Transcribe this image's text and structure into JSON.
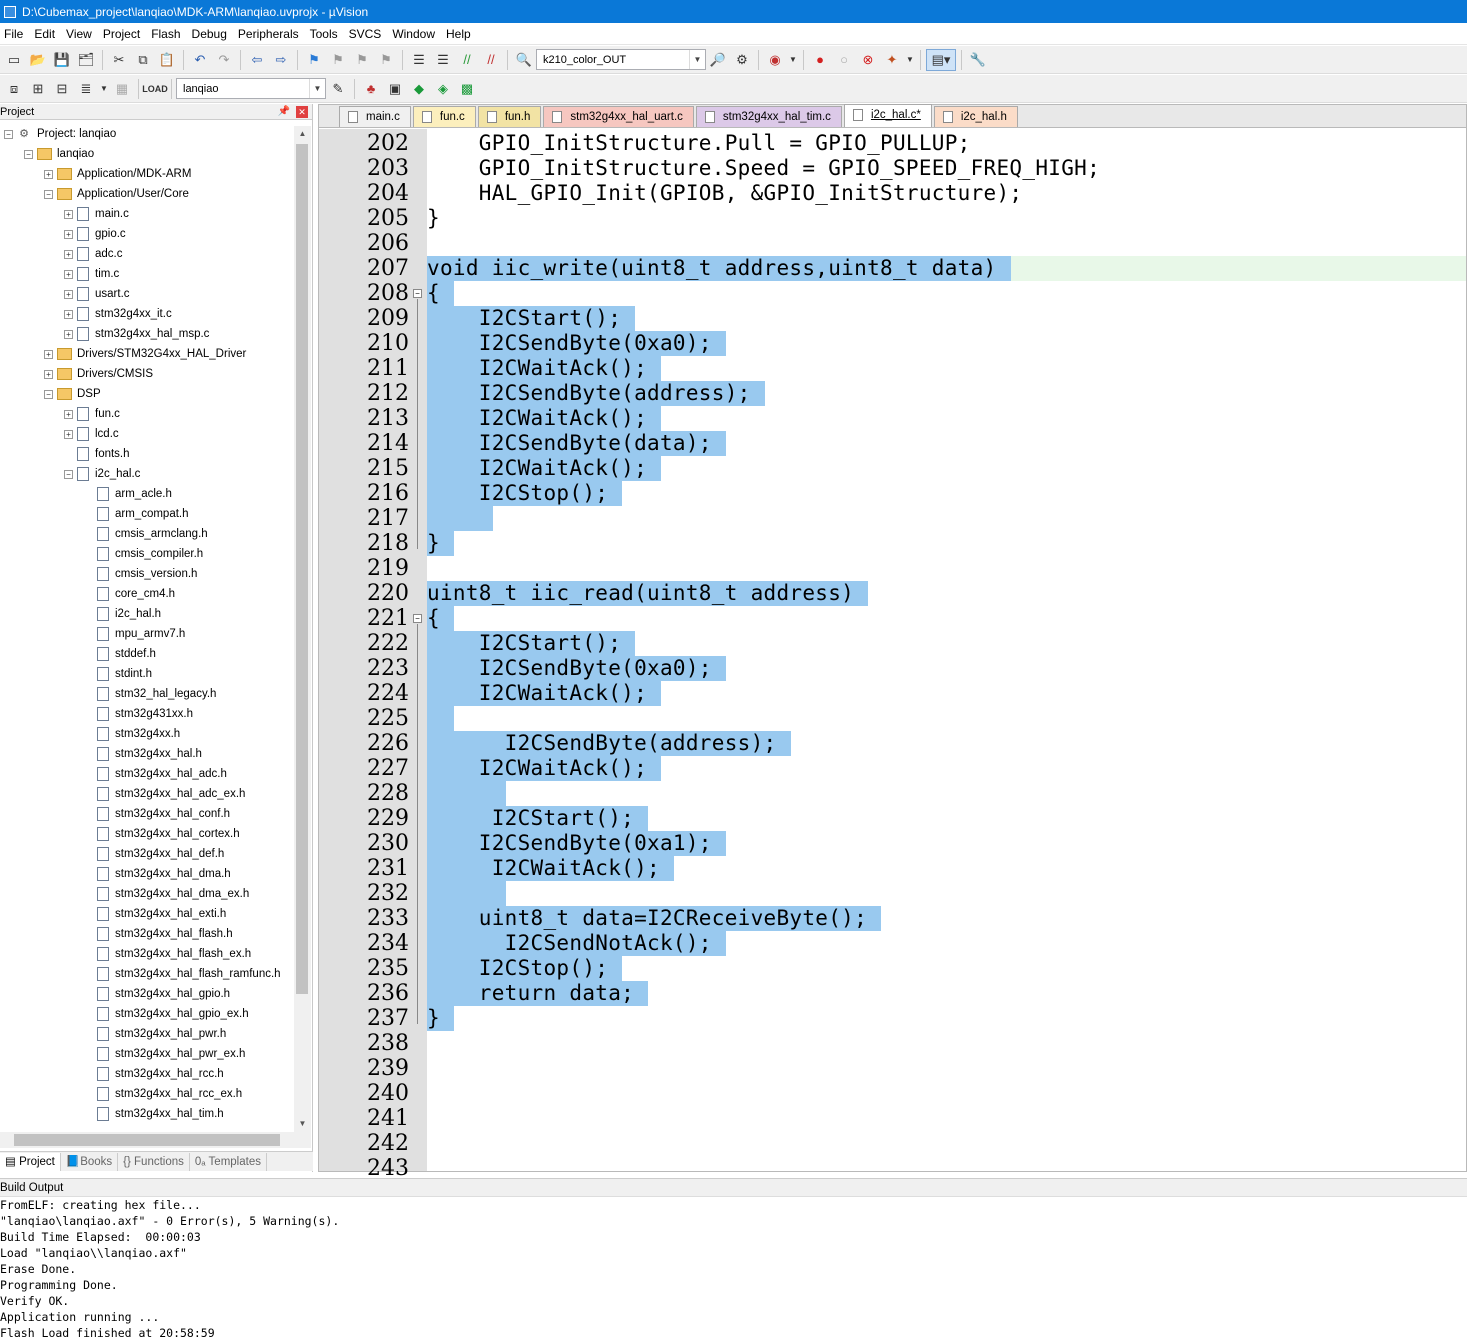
{
  "window": {
    "title": "D:\\Cubemax_project\\lanqiao\\MDK-ARM\\lanqiao.uvprojx - µVision"
  },
  "menu": [
    "File",
    "Edit",
    "View",
    "Project",
    "Flash",
    "Debug",
    "Peripherals",
    "Tools",
    "SVCS",
    "Window",
    "Help"
  ],
  "toolbar": {
    "target_combo": "k210_color_OUT",
    "project_combo": "lanqiao"
  },
  "project_panel": {
    "title": "Project",
    "tree": [
      {
        "d": 0,
        "t": "project",
        "exp": "-",
        "label": "Project: lanqiao"
      },
      {
        "d": 1,
        "t": "folder",
        "exp": "-",
        "label": "lanqiao"
      },
      {
        "d": 2,
        "t": "folder",
        "exp": "+",
        "label": "Application/MDK-ARM"
      },
      {
        "d": 2,
        "t": "folder",
        "exp": "-",
        "label": "Application/User/Core"
      },
      {
        "d": 3,
        "t": "file",
        "exp": "+",
        "label": "main.c"
      },
      {
        "d": 3,
        "t": "file",
        "exp": "+",
        "label": "gpio.c"
      },
      {
        "d": 3,
        "t": "file",
        "exp": "+",
        "label": "adc.c"
      },
      {
        "d": 3,
        "t": "file",
        "exp": "+",
        "label": "tim.c"
      },
      {
        "d": 3,
        "t": "file",
        "exp": "+",
        "label": "usart.c"
      },
      {
        "d": 3,
        "t": "file",
        "exp": "+",
        "label": "stm32g4xx_it.c"
      },
      {
        "d": 3,
        "t": "file",
        "exp": "+",
        "label": "stm32g4xx_hal_msp.c"
      },
      {
        "d": 2,
        "t": "folder",
        "exp": "+",
        "label": "Drivers/STM32G4xx_HAL_Driver"
      },
      {
        "d": 2,
        "t": "folder",
        "exp": "+",
        "label": "Drivers/CMSIS"
      },
      {
        "d": 2,
        "t": "folder",
        "exp": "-",
        "label": "DSP"
      },
      {
        "d": 3,
        "t": "file",
        "exp": "+",
        "label": "fun.c"
      },
      {
        "d": 3,
        "t": "file",
        "exp": "+",
        "label": "lcd.c"
      },
      {
        "d": 3,
        "t": "file",
        "exp": "",
        "label": "fonts.h"
      },
      {
        "d": 3,
        "t": "file",
        "exp": "-",
        "label": "i2c_hal.c"
      },
      {
        "d": 4,
        "t": "file",
        "exp": "",
        "label": "arm_acle.h"
      },
      {
        "d": 4,
        "t": "file",
        "exp": "",
        "label": "arm_compat.h"
      },
      {
        "d": 4,
        "t": "file",
        "exp": "",
        "label": "cmsis_armclang.h"
      },
      {
        "d": 4,
        "t": "file",
        "exp": "",
        "label": "cmsis_compiler.h"
      },
      {
        "d": 4,
        "t": "file",
        "exp": "",
        "label": "cmsis_version.h"
      },
      {
        "d": 4,
        "t": "file",
        "exp": "",
        "label": "core_cm4.h"
      },
      {
        "d": 4,
        "t": "file",
        "exp": "",
        "label": "i2c_hal.h"
      },
      {
        "d": 4,
        "t": "file",
        "exp": "",
        "label": "mpu_armv7.h"
      },
      {
        "d": 4,
        "t": "file",
        "exp": "",
        "label": "stddef.h"
      },
      {
        "d": 4,
        "t": "file",
        "exp": "",
        "label": "stdint.h"
      },
      {
        "d": 4,
        "t": "file",
        "exp": "",
        "label": "stm32_hal_legacy.h"
      },
      {
        "d": 4,
        "t": "file",
        "exp": "",
        "label": "stm32g431xx.h"
      },
      {
        "d": 4,
        "t": "file",
        "exp": "",
        "label": "stm32g4xx.h"
      },
      {
        "d": 4,
        "t": "file",
        "exp": "",
        "label": "stm32g4xx_hal.h"
      },
      {
        "d": 4,
        "t": "file",
        "exp": "",
        "label": "stm32g4xx_hal_adc.h"
      },
      {
        "d": 4,
        "t": "file",
        "exp": "",
        "label": "stm32g4xx_hal_adc_ex.h"
      },
      {
        "d": 4,
        "t": "file",
        "exp": "",
        "label": "stm32g4xx_hal_conf.h"
      },
      {
        "d": 4,
        "t": "file",
        "exp": "",
        "label": "stm32g4xx_hal_cortex.h"
      },
      {
        "d": 4,
        "t": "file",
        "exp": "",
        "label": "stm32g4xx_hal_def.h"
      },
      {
        "d": 4,
        "t": "file",
        "exp": "",
        "label": "stm32g4xx_hal_dma.h"
      },
      {
        "d": 4,
        "t": "file",
        "exp": "",
        "label": "stm32g4xx_hal_dma_ex.h"
      },
      {
        "d": 4,
        "t": "file",
        "exp": "",
        "label": "stm32g4xx_hal_exti.h"
      },
      {
        "d": 4,
        "t": "file",
        "exp": "",
        "label": "stm32g4xx_hal_flash.h"
      },
      {
        "d": 4,
        "t": "file",
        "exp": "",
        "label": "stm32g4xx_hal_flash_ex.h"
      },
      {
        "d": 4,
        "t": "file",
        "exp": "",
        "label": "stm32g4xx_hal_flash_ramfunc.h"
      },
      {
        "d": 4,
        "t": "file",
        "exp": "",
        "label": "stm32g4xx_hal_gpio.h"
      },
      {
        "d": 4,
        "t": "file",
        "exp": "",
        "label": "stm32g4xx_hal_gpio_ex.h"
      },
      {
        "d": 4,
        "t": "file",
        "exp": "",
        "label": "stm32g4xx_hal_pwr.h"
      },
      {
        "d": 4,
        "t": "file",
        "exp": "",
        "label": "stm32g4xx_hal_pwr_ex.h"
      },
      {
        "d": 4,
        "t": "file",
        "exp": "",
        "label": "stm32g4xx_hal_rcc.h"
      },
      {
        "d": 4,
        "t": "file",
        "exp": "",
        "label": "stm32g4xx_hal_rcc_ex.h"
      },
      {
        "d": 4,
        "t": "file",
        "exp": "",
        "label": "stm32g4xx_hal_tim.h"
      }
    ],
    "bottom_tabs": [
      "Project",
      "Books",
      "{} Functions",
      "0ₐ Templates"
    ]
  },
  "editor": {
    "tabs": [
      {
        "label": "main.c",
        "color": "#f0f0f0",
        "active": false
      },
      {
        "label": "fun.c",
        "color": "#fcefbd",
        "active": false
      },
      {
        "label": "fun.h",
        "color": "#f2e3a4",
        "active": false
      },
      {
        "label": "stm32g4xx_hal_uart.c",
        "color": "#f6c7c0",
        "active": false
      },
      {
        "label": "stm32g4xx_hal_tim.c",
        "color": "#dcc9e8",
        "active": false
      },
      {
        "label": "i2c_hal.c*",
        "color": "#ffffff",
        "active": true
      },
      {
        "label": "i2c_hal.h",
        "color": "#fbdcc8",
        "active": false
      }
    ],
    "lines": [
      {
        "n": "202",
        "code": "    GPIO_InitStructure.Pull = GPIO_PULLUP;",
        "sel": 0
      },
      {
        "n": "203",
        "code": "    GPIO_InitStructure.Speed = GPIO_SPEED_FREQ_HIGH;",
        "sel": 0
      },
      {
        "n": "204",
        "code": "    HAL_GPIO_Init(GPIOB, &GPIO_InitStructure);",
        "sel": 0
      },
      {
        "n": "205",
        "code": "}",
        "sel": 0
      },
      {
        "n": "206",
        "code": "",
        "sel": 0
      },
      {
        "n": "207",
        "code": "void iic_write(uint8_t address,uint8_t data)",
        "sel": 1,
        "cur": true
      },
      {
        "n": "208",
        "code": "{",
        "sel": 1,
        "fold": "-"
      },
      {
        "n": "209",
        "code": "    I2CStart();",
        "sel": 1
      },
      {
        "n": "210",
        "code": "    I2CSendByte(0xa0);",
        "sel": 1
      },
      {
        "n": "211",
        "code": "    I2CWaitAck();",
        "sel": 1
      },
      {
        "n": "212",
        "code": "    I2CSendByte(address);",
        "sel": 1
      },
      {
        "n": "213",
        "code": "    I2CWaitAck();",
        "sel": 1
      },
      {
        "n": "214",
        "code": "    I2CSendByte(data);",
        "sel": 1
      },
      {
        "n": "215",
        "code": "    I2CWaitAck();",
        "sel": 1
      },
      {
        "n": "216",
        "code": "    I2CStop();",
        "sel": 1
      },
      {
        "n": "217",
        "code": "    ",
        "sel": 1
      },
      {
        "n": "218",
        "code": "}",
        "sel": 1
      },
      {
        "n": "219",
        "code": "",
        "sel": 0
      },
      {
        "n": "220",
        "code": "uint8_t iic_read(uint8_t address)",
        "sel": 1
      },
      {
        "n": "221",
        "code": "{",
        "sel": 1,
        "fold": "-"
      },
      {
        "n": "222",
        "code": "    I2CStart();",
        "sel": 1
      },
      {
        "n": "223",
        "code": "    I2CSendByte(0xa0);",
        "sel": 1
      },
      {
        "n": "224",
        "code": "    I2CWaitAck();",
        "sel": 1
      },
      {
        "n": "225",
        "code": " ",
        "sel": 1
      },
      {
        "n": "226",
        "code": "      I2CSendByte(address);",
        "sel": 1
      },
      {
        "n": "227",
        "code": "    I2CWaitAck();",
        "sel": 1
      },
      {
        "n": "228",
        "code": "     ",
        "sel": 1
      },
      {
        "n": "229",
        "code": "     I2CStart();",
        "sel": 1
      },
      {
        "n": "230",
        "code": "    I2CSendByte(0xa1);",
        "sel": 1
      },
      {
        "n": "231",
        "code": "     I2CWaitAck();",
        "sel": 1
      },
      {
        "n": "232",
        "code": "     ",
        "sel": 1
      },
      {
        "n": "233",
        "code": "    uint8_t data=I2CReceiveByte();",
        "sel": 1
      },
      {
        "n": "234",
        "code": "      I2CSendNotAck();",
        "sel": 1
      },
      {
        "n": "235",
        "code": "    I2CStop();",
        "sel": 1
      },
      {
        "n": "236",
        "code": "    return data;",
        "sel": 1
      },
      {
        "n": "237",
        "code": "}",
        "sel": 1
      },
      {
        "n": "238",
        "code": "",
        "sel": 0
      },
      {
        "n": "239",
        "code": "",
        "sel": 0
      },
      {
        "n": "240",
        "code": "",
        "sel": 0
      },
      {
        "n": "241",
        "code": "",
        "sel": 0
      },
      {
        "n": "242",
        "code": "",
        "sel": 0
      },
      {
        "n": "243",
        "code": "",
        "sel": 0
      }
    ]
  },
  "build_output": {
    "title": "Build Output",
    "lines": [
      "FromELF: creating hex file...",
      "\"lanqiao\\lanqiao.axf\" - 0 Error(s), 5 Warning(s).",
      "Build Time Elapsed:  00:00:03",
      "Load \"lanqiao\\\\lanqiao.axf\"",
      "Erase Done.",
      "Programming Done.",
      "Verify OK.",
      "Application running ...",
      "Flash Load finished at 20:58:59"
    ]
  }
}
